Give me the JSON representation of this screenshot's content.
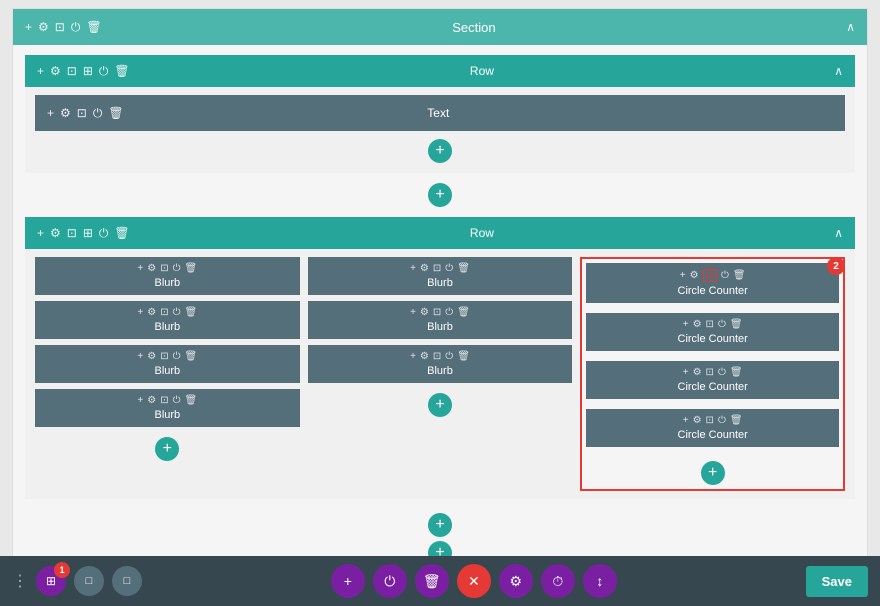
{
  "section": {
    "title": "Section",
    "chevron": "^"
  },
  "row1": {
    "title": "Row",
    "text_module": "Text"
  },
  "row2": {
    "title": "Row"
  },
  "col1": {
    "items": [
      "Blurb",
      "Blurb",
      "Blurb",
      "Blurb"
    ]
  },
  "col2": {
    "items": [
      "Blurb",
      "Blurb",
      "Blurb"
    ]
  },
  "col3": {
    "items": [
      "Circle Counter",
      "Circle Counter",
      "Circle Counter",
      "Circle Counter"
    ],
    "badge_count": "2"
  },
  "toolbar": {
    "save_label": "Save",
    "icons": [
      "⋮",
      "⊞",
      "□",
      "□"
    ],
    "badge_count": "1",
    "center_icons": [
      "+",
      "⏻",
      "🗑",
      "✕",
      "⚙",
      "⏱",
      "↕"
    ]
  }
}
